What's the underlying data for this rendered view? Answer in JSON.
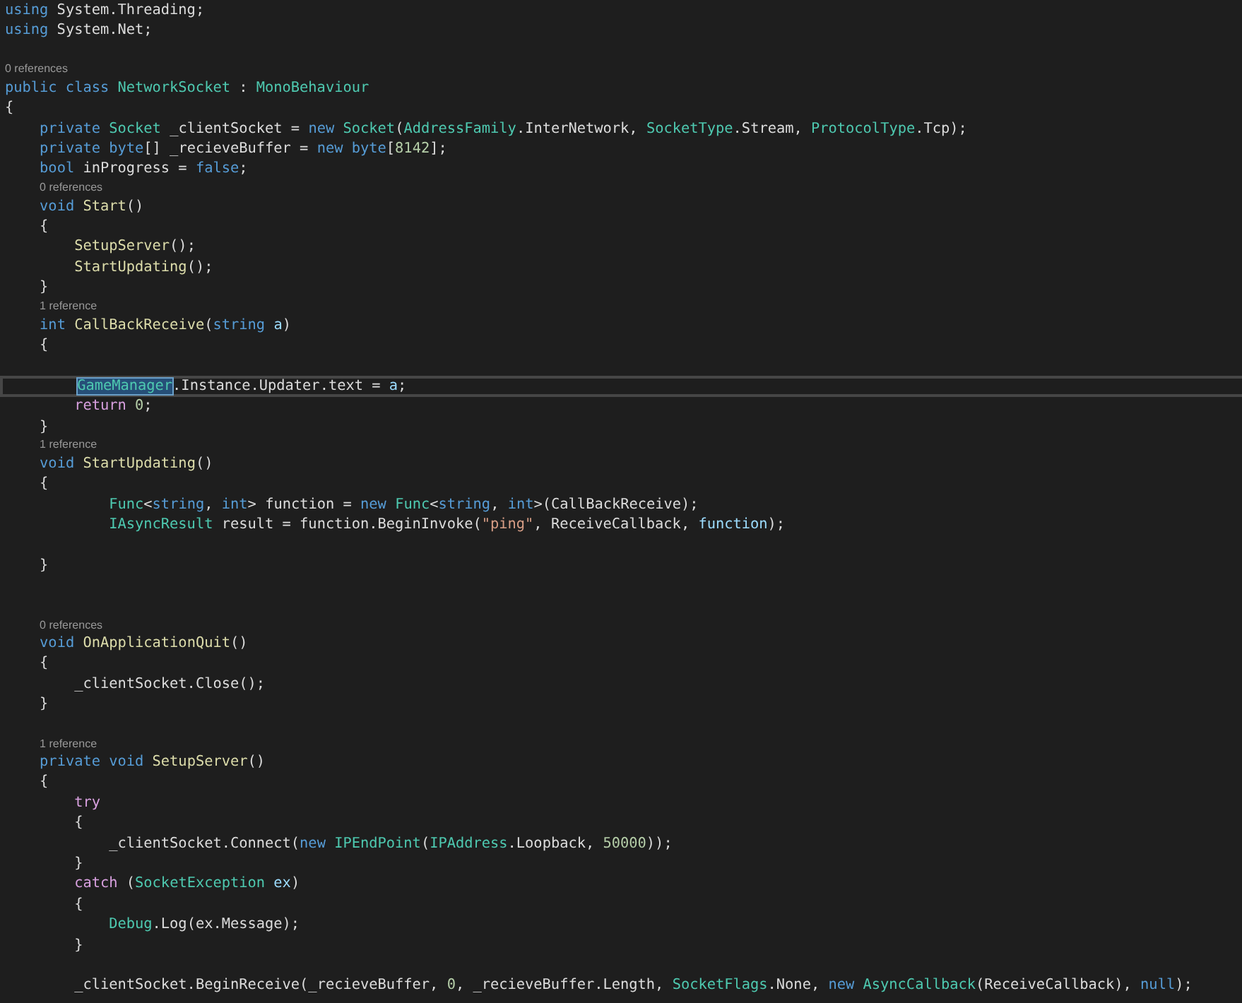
{
  "editor": {
    "lines": [
      {
        "kind": "code",
        "current": false,
        "tokens": [
          {
            "kind": "kw",
            "text": "using"
          },
          {
            "kind": "plain",
            "text": " System.Threading;"
          }
        ]
      },
      {
        "kind": "code",
        "current": false,
        "tokens": [
          {
            "kind": "kw",
            "text": "using"
          },
          {
            "kind": "plain",
            "text": " System.Net;"
          }
        ]
      },
      {
        "kind": "blank"
      },
      {
        "kind": "lens",
        "text": "0 references"
      },
      {
        "kind": "code",
        "current": false,
        "tokens": [
          {
            "kind": "kw",
            "text": "public class "
          },
          {
            "kind": "type",
            "text": "NetworkSocket"
          },
          {
            "kind": "plain",
            "text": " : "
          },
          {
            "kind": "type",
            "text": "MonoBehaviour"
          }
        ]
      },
      {
        "kind": "code",
        "current": false,
        "tokens": [
          {
            "kind": "plain",
            "text": "{"
          }
        ]
      },
      {
        "kind": "code",
        "current": false,
        "tokens": [
          {
            "kind": "kw",
            "text": "    private "
          },
          {
            "kind": "type",
            "text": "Socket "
          },
          {
            "kind": "plain",
            "text": "_clientSocket = "
          },
          {
            "kind": "kw",
            "text": "new "
          },
          {
            "kind": "type",
            "text": "Socket"
          },
          {
            "kind": "plain",
            "text": "("
          },
          {
            "kind": "type",
            "text": "AddressFamily"
          },
          {
            "kind": "plain",
            "text": ".InterNetwork, "
          },
          {
            "kind": "type",
            "text": "SocketType"
          },
          {
            "kind": "plain",
            "text": ".Stream, "
          },
          {
            "kind": "type",
            "text": "ProtocolType"
          },
          {
            "kind": "plain",
            "text": ".Tcp);"
          }
        ]
      },
      {
        "kind": "code",
        "current": false,
        "tokens": [
          {
            "kind": "kw",
            "text": "    private byte"
          },
          {
            "kind": "plain",
            "text": "[] _recieveBuffer = "
          },
          {
            "kind": "kw",
            "text": "new byte"
          },
          {
            "kind": "plain",
            "text": "["
          },
          {
            "kind": "num",
            "text": "8142"
          },
          {
            "kind": "plain",
            "text": "];"
          }
        ]
      },
      {
        "kind": "code",
        "current": false,
        "tokens": [
          {
            "kind": "kw",
            "text": "    bool "
          },
          {
            "kind": "plain",
            "text": "inProgress = "
          },
          {
            "kind": "kw",
            "text": "false"
          },
          {
            "kind": "plain",
            "text": ";"
          }
        ]
      },
      {
        "kind": "lens",
        "text": "    0 references"
      },
      {
        "kind": "code",
        "current": false,
        "tokens": [
          {
            "kind": "kw",
            "text": "    void "
          },
          {
            "kind": "method",
            "text": "Start"
          },
          {
            "kind": "plain",
            "text": "()"
          }
        ]
      },
      {
        "kind": "code",
        "current": false,
        "tokens": [
          {
            "kind": "plain",
            "text": "    {"
          }
        ]
      },
      {
        "kind": "code",
        "current": false,
        "tokens": [
          {
            "kind": "method",
            "text": "        SetupServer"
          },
          {
            "kind": "plain",
            "text": "();"
          }
        ]
      },
      {
        "kind": "code",
        "current": false,
        "tokens": [
          {
            "kind": "method",
            "text": "        StartUpdating"
          },
          {
            "kind": "plain",
            "text": "();"
          }
        ]
      },
      {
        "kind": "code",
        "current": false,
        "tokens": [
          {
            "kind": "plain",
            "text": "    }"
          }
        ]
      },
      {
        "kind": "lens",
        "text": "    1 reference"
      },
      {
        "kind": "code",
        "current": false,
        "tokens": [
          {
            "kind": "kw",
            "text": "    int "
          },
          {
            "kind": "method",
            "text": "CallBackReceive"
          },
          {
            "kind": "plain",
            "text": "("
          },
          {
            "kind": "kw",
            "text": "string "
          },
          {
            "kind": "var",
            "text": "a"
          },
          {
            "kind": "plain",
            "text": ")"
          }
        ]
      },
      {
        "kind": "code",
        "current": false,
        "tokens": [
          {
            "kind": "plain",
            "text": "    {"
          }
        ]
      },
      {
        "kind": "blank"
      },
      {
        "kind": "code",
        "current": true,
        "tokens": [
          {
            "kind": "selection",
            "text": "        GameManager"
          },
          {
            "kind": "plain",
            "text": ".Instance.Updater.text = "
          },
          {
            "kind": "var",
            "text": "a"
          },
          {
            "kind": "plain",
            "text": ";"
          }
        ]
      },
      {
        "kind": "code",
        "current": false,
        "tokens": [
          {
            "kind": "ctl",
            "text": "        return "
          },
          {
            "kind": "num",
            "text": "0"
          },
          {
            "kind": "plain",
            "text": ";"
          }
        ]
      },
      {
        "kind": "code",
        "current": false,
        "tokens": [
          {
            "kind": "plain",
            "text": "    }"
          }
        ]
      },
      {
        "kind": "lens",
        "text": "    1 reference"
      },
      {
        "kind": "code",
        "current": false,
        "tokens": [
          {
            "kind": "kw",
            "text": "    void "
          },
          {
            "kind": "method",
            "text": "StartUpdating"
          },
          {
            "kind": "plain",
            "text": "()"
          }
        ]
      },
      {
        "kind": "code",
        "current": false,
        "tokens": [
          {
            "kind": "plain",
            "text": "    {"
          }
        ]
      },
      {
        "kind": "code",
        "current": false,
        "tokens": [
          {
            "kind": "type",
            "text": "            Func"
          },
          {
            "kind": "plain",
            "text": "<"
          },
          {
            "kind": "kw",
            "text": "string"
          },
          {
            "kind": "plain",
            "text": ", "
          },
          {
            "kind": "kw",
            "text": "int"
          },
          {
            "kind": "plain",
            "text": "> function = "
          },
          {
            "kind": "kw",
            "text": "new "
          },
          {
            "kind": "type",
            "text": "Func"
          },
          {
            "kind": "plain",
            "text": "<"
          },
          {
            "kind": "kw",
            "text": "string"
          },
          {
            "kind": "plain",
            "text": ", "
          },
          {
            "kind": "kw",
            "text": "int"
          },
          {
            "kind": "plain",
            "text": ">(CallBackReceive);"
          }
        ]
      },
      {
        "kind": "code",
        "current": false,
        "tokens": [
          {
            "kind": "type",
            "text": "            IAsyncResult"
          },
          {
            "kind": "plain",
            "text": " result = function.BeginInvoke("
          },
          {
            "kind": "str",
            "text": "\"ping\""
          },
          {
            "kind": "plain",
            "text": ", ReceiveCallback, "
          },
          {
            "kind": "var",
            "text": "function"
          },
          {
            "kind": "plain",
            "text": ");"
          }
        ]
      },
      {
        "kind": "blank"
      },
      {
        "kind": "code",
        "current": false,
        "tokens": [
          {
            "kind": "plain",
            "text": "    }"
          }
        ]
      },
      {
        "kind": "blank"
      },
      {
        "kind": "blank"
      },
      {
        "kind": "lens",
        "text": "    0 references"
      },
      {
        "kind": "code",
        "current": false,
        "tokens": [
          {
            "kind": "kw",
            "text": "    void "
          },
          {
            "kind": "method",
            "text": "OnApplicationQuit"
          },
          {
            "kind": "plain",
            "text": "()"
          }
        ]
      },
      {
        "kind": "code",
        "current": false,
        "tokens": [
          {
            "kind": "plain",
            "text": "    {"
          }
        ]
      },
      {
        "kind": "code",
        "current": false,
        "tokens": [
          {
            "kind": "plain",
            "text": "        _clientSocket.Close();"
          }
        ]
      },
      {
        "kind": "code",
        "current": false,
        "tokens": [
          {
            "kind": "plain",
            "text": "    }"
          }
        ]
      },
      {
        "kind": "blank"
      },
      {
        "kind": "lens",
        "text": "    1 reference"
      },
      {
        "kind": "code",
        "current": false,
        "tokens": [
          {
            "kind": "kw",
            "text": "    private void "
          },
          {
            "kind": "method",
            "text": "SetupServer"
          },
          {
            "kind": "plain",
            "text": "()"
          }
        ]
      },
      {
        "kind": "code",
        "current": false,
        "tokens": [
          {
            "kind": "plain",
            "text": "    {"
          }
        ]
      },
      {
        "kind": "code",
        "current": false,
        "tokens": [
          {
            "kind": "ctl",
            "text": "        try"
          }
        ]
      },
      {
        "kind": "code",
        "current": false,
        "tokens": [
          {
            "kind": "plain",
            "text": "        {"
          }
        ]
      },
      {
        "kind": "code",
        "current": false,
        "tokens": [
          {
            "kind": "plain",
            "text": "            _clientSocket.Connect("
          },
          {
            "kind": "kw",
            "text": "new "
          },
          {
            "kind": "type",
            "text": "IPEndPoint"
          },
          {
            "kind": "plain",
            "text": "("
          },
          {
            "kind": "type",
            "text": "IPAddress"
          },
          {
            "kind": "plain",
            "text": ".Loopback, "
          },
          {
            "kind": "num",
            "text": "50000"
          },
          {
            "kind": "plain",
            "text": "));"
          }
        ]
      },
      {
        "kind": "code",
        "current": false,
        "tokens": [
          {
            "kind": "plain",
            "text": "        }"
          }
        ]
      },
      {
        "kind": "code",
        "current": false,
        "tokens": [
          {
            "kind": "ctl",
            "text": "        catch "
          },
          {
            "kind": "plain",
            "text": "("
          },
          {
            "kind": "type",
            "text": "SocketException "
          },
          {
            "kind": "var",
            "text": "ex"
          },
          {
            "kind": "plain",
            "text": ")"
          }
        ]
      },
      {
        "kind": "code",
        "current": false,
        "tokens": [
          {
            "kind": "plain",
            "text": "        {"
          }
        ]
      },
      {
        "kind": "code",
        "current": false,
        "tokens": [
          {
            "kind": "type",
            "text": "            Debug"
          },
          {
            "kind": "plain",
            "text": ".Log(ex.Message);"
          }
        ]
      },
      {
        "kind": "code",
        "current": false,
        "tokens": [
          {
            "kind": "plain",
            "text": "        }"
          }
        ]
      },
      {
        "kind": "blank"
      },
      {
        "kind": "code",
        "current": false,
        "tokens": [
          {
            "kind": "plain",
            "text": "        _clientSocket.BeginReceive(_recieveBuffer, "
          },
          {
            "kind": "num",
            "text": "0"
          },
          {
            "kind": "plain",
            "text": ", _recieveBuffer.Length, "
          },
          {
            "kind": "type",
            "text": "SocketFlags"
          },
          {
            "kind": "plain",
            "text": ".None, "
          },
          {
            "kind": "kw",
            "text": "new "
          },
          {
            "kind": "type",
            "text": "AsyncCallback"
          },
          {
            "kind": "plain",
            "text": "(ReceiveCallback), "
          },
          {
            "kind": "kw",
            "text": "null"
          },
          {
            "kind": "plain",
            "text": ");"
          }
        ]
      }
    ]
  }
}
